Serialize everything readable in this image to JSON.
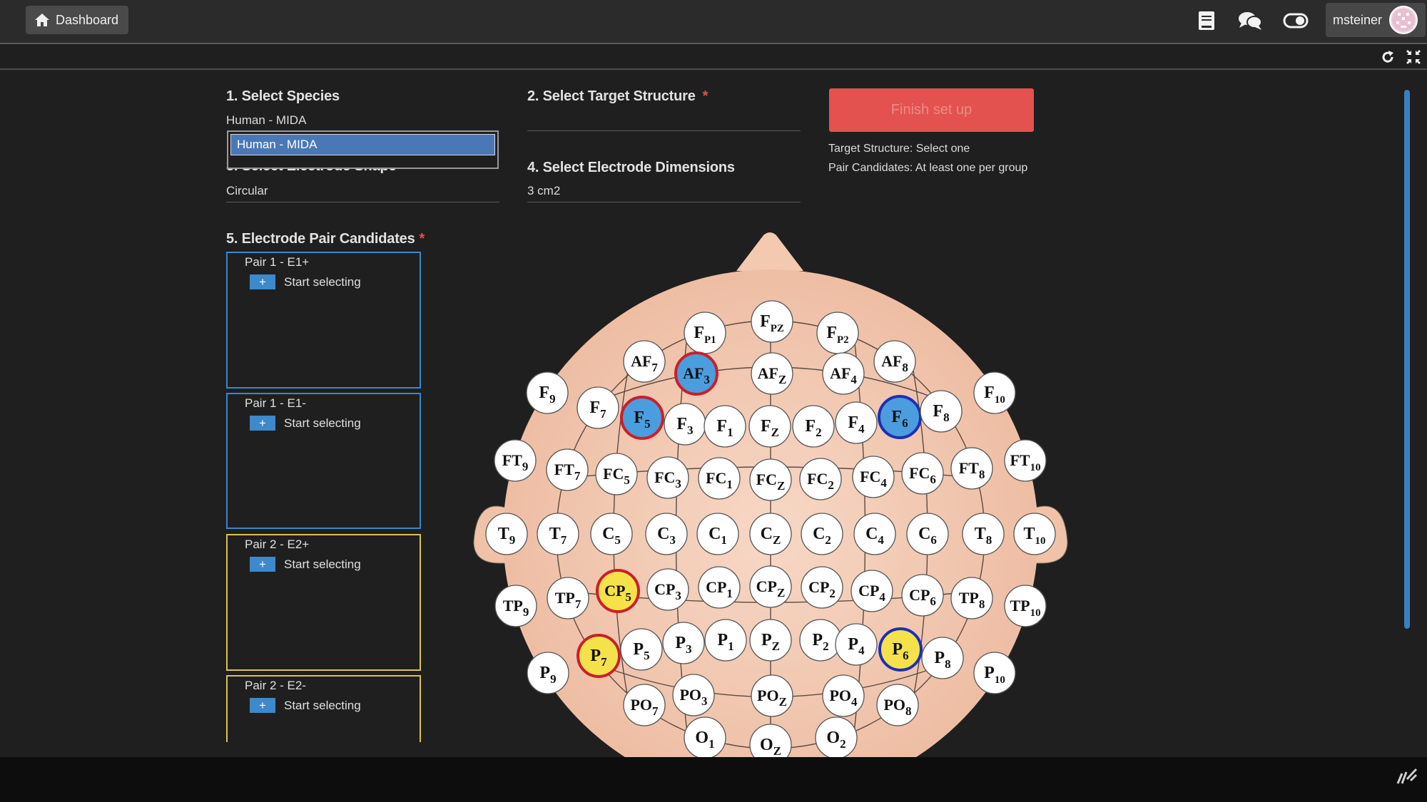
{
  "topbar": {
    "dashboard_label": "Dashboard",
    "username": "msteiner"
  },
  "form": {
    "species": {
      "title": "1. Select Species",
      "value": "Human - MIDA",
      "option": "Human - MIDA"
    },
    "target": {
      "title": "2. Select Target Structure",
      "required": "*",
      "value": ""
    },
    "shape": {
      "title": "3. Select Electrode Shape",
      "value": "Circular"
    },
    "dimensions": {
      "title": "4. Select Electrode Dimensions",
      "value": "3 cm2"
    },
    "finish_label": "Finish set up",
    "info": {
      "target": "Target Structure: Select one",
      "pairs": "Pair Candidates: At least one per group"
    },
    "candidates": {
      "title": "5. Electrode Pair Candidates",
      "required": "*",
      "pairs": [
        {
          "label": "Pair 1 - E1+",
          "action": "Start selecting"
        },
        {
          "label": "Pair 1 - E1-",
          "action": "Start selecting"
        },
        {
          "label": "Pair 2 - E2+",
          "action": "Start selecting"
        },
        {
          "label": "Pair 2 - E2-",
          "action": "Start selecting"
        }
      ]
    }
  },
  "colors": {
    "e1_positive": "#4b9ddd",
    "e1_negative": "#4b9ddd",
    "e2_positive": "#f5e24a",
    "e2_negative": "#f5e24a",
    "accent_red": "#e3524f",
    "accent_blue": "#3d89c9",
    "ring_red": "#c8202a",
    "ring_blue": "#1d2fb5"
  },
  "icons": {
    "dashboard": "home-icon",
    "docs": "book-icon",
    "chat": "chat-icon",
    "toggle": "toggle-icon",
    "refresh": "refresh-icon",
    "collapse": "collapse-icon"
  },
  "electrodes": [
    {
      "b": "F",
      "s": "PZ"
    },
    {
      "b": "F",
      "s": "P1"
    },
    {
      "b": "F",
      "s": "P2"
    },
    {
      "b": "AF",
      "s": "7"
    },
    {
      "b": "AF",
      "s": "3",
      "fill": "blue",
      "ring": "red"
    },
    {
      "b": "AF",
      "s": "Z"
    },
    {
      "b": "AF",
      "s": "4"
    },
    {
      "b": "AF",
      "s": "8"
    },
    {
      "b": "F",
      "s": "9"
    },
    {
      "b": "F",
      "s": "7"
    },
    {
      "b": "F",
      "s": "5",
      "fill": "blue",
      "ring": "red"
    },
    {
      "b": "F",
      "s": "3"
    },
    {
      "b": "F",
      "s": "1"
    },
    {
      "b": "F",
      "s": "Z"
    },
    {
      "b": "F",
      "s": "2"
    },
    {
      "b": "F",
      "s": "4"
    },
    {
      "b": "F",
      "s": "6",
      "fill": "blue",
      "ring": "blue"
    },
    {
      "b": "F",
      "s": "8"
    },
    {
      "b": "F",
      "s": "10"
    },
    {
      "b": "FT",
      "s": "9"
    },
    {
      "b": "FT",
      "s": "7"
    },
    {
      "b": "FC",
      "s": "5"
    },
    {
      "b": "FC",
      "s": "3"
    },
    {
      "b": "FC",
      "s": "1"
    },
    {
      "b": "FC",
      "s": "Z"
    },
    {
      "b": "FC",
      "s": "2"
    },
    {
      "b": "FC",
      "s": "4"
    },
    {
      "b": "FC",
      "s": "6"
    },
    {
      "b": "FT",
      "s": "8"
    },
    {
      "b": "FT",
      "s": "10"
    },
    {
      "b": "T",
      "s": "9"
    },
    {
      "b": "T",
      "s": "7"
    },
    {
      "b": "C",
      "s": "5"
    },
    {
      "b": "C",
      "s": "3"
    },
    {
      "b": "C",
      "s": "1"
    },
    {
      "b": "C",
      "s": "Z"
    },
    {
      "b": "C",
      "s": "2"
    },
    {
      "b": "C",
      "s": "4"
    },
    {
      "b": "C",
      "s": "6"
    },
    {
      "b": "T",
      "s": "8"
    },
    {
      "b": "T",
      "s": "10"
    },
    {
      "b": "TP",
      "s": "9"
    },
    {
      "b": "TP",
      "s": "7"
    },
    {
      "b": "CP",
      "s": "5",
      "fill": "yellow",
      "ring": "red"
    },
    {
      "b": "CP",
      "s": "3"
    },
    {
      "b": "CP",
      "s": "1"
    },
    {
      "b": "CP",
      "s": "Z"
    },
    {
      "b": "CP",
      "s": "2"
    },
    {
      "b": "CP",
      "s": "4"
    },
    {
      "b": "CP",
      "s": "6"
    },
    {
      "b": "TP",
      "s": "8"
    },
    {
      "b": "TP",
      "s": "10"
    },
    {
      "b": "P",
      "s": "9"
    },
    {
      "b": "P",
      "s": "7",
      "fill": "yellow",
      "ring": "red"
    },
    {
      "b": "P",
      "s": "5"
    },
    {
      "b": "P",
      "s": "3"
    },
    {
      "b": "P",
      "s": "1"
    },
    {
      "b": "P",
      "s": "Z"
    },
    {
      "b": "P",
      "s": "2"
    },
    {
      "b": "P",
      "s": "4"
    },
    {
      "b": "P",
      "s": "6",
      "fill": "yellow",
      "ring": "blue"
    },
    {
      "b": "P",
      "s": "8"
    },
    {
      "b": "P",
      "s": "10"
    },
    {
      "b": "PO",
      "s": "7"
    },
    {
      "b": "PO",
      "s": "3"
    },
    {
      "b": "PO",
      "s": "Z"
    },
    {
      "b": "PO",
      "s": "4"
    },
    {
      "b": "PO",
      "s": "8"
    },
    {
      "b": "O",
      "s": "1"
    },
    {
      "b": "O",
      "s": "Z"
    },
    {
      "b": "O",
      "s": "2"
    }
  ]
}
